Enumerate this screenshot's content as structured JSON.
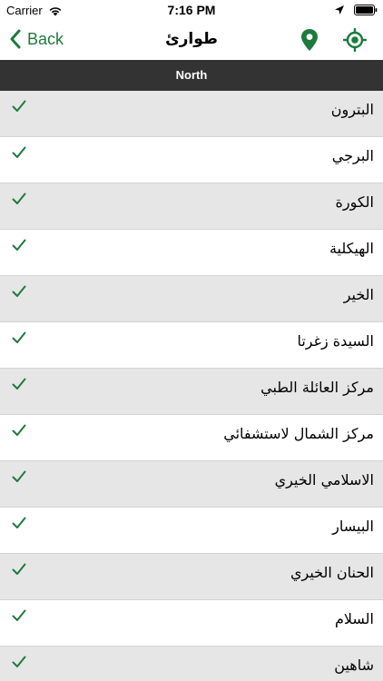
{
  "status_bar": {
    "carrier": "Carrier",
    "time": "7:16 PM"
  },
  "nav": {
    "back_label": "Back",
    "title": "طوارئ"
  },
  "section": {
    "title": "North"
  },
  "colors": {
    "accent": "#1e7a3c",
    "section_bg": "#333333",
    "row_shaded": "#e6e6e6"
  },
  "icons": {
    "back": "chevron-left-icon",
    "map": "map-pin-icon",
    "locate": "gps-target-icon",
    "row": "checkmark-icon"
  },
  "items": [
    {
      "label": "البترون",
      "checked": true
    },
    {
      "label": "البرجي",
      "checked": true
    },
    {
      "label": "الكورة",
      "checked": true
    },
    {
      "label": "الهيكلية",
      "checked": true
    },
    {
      "label": "الخير",
      "checked": true
    },
    {
      "label": "السيدة زغرتا",
      "checked": true
    },
    {
      "label": "مركز العائلة الطبي",
      "checked": true
    },
    {
      "label": "مركز الشمال لاستشفائي",
      "checked": true
    },
    {
      "label": "الاسلامي الخيري",
      "checked": true
    },
    {
      "label": "البيسار",
      "checked": true
    },
    {
      "label": "الحنان الخيري",
      "checked": true
    },
    {
      "label": "السلام",
      "checked": true
    },
    {
      "label": "شاهين",
      "checked": true
    }
  ]
}
